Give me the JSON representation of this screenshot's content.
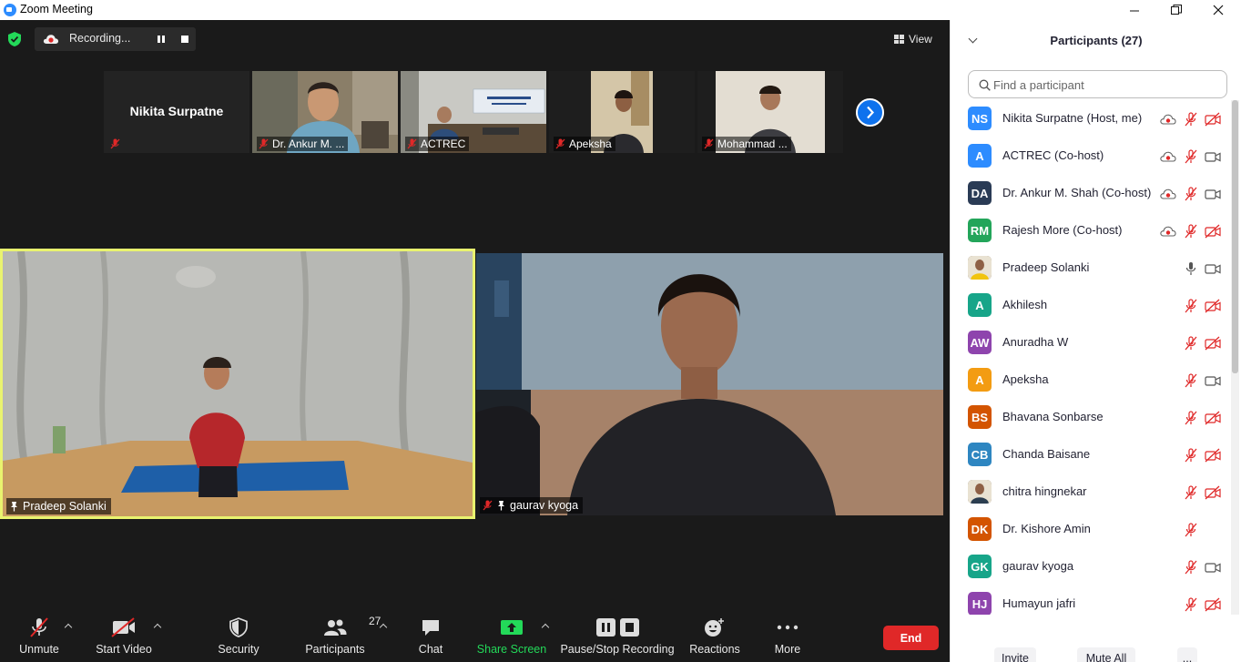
{
  "window": {
    "title": "Zoom Meeting",
    "minimize": "—",
    "maximize": "❐",
    "close": "✕"
  },
  "meeting": {
    "recording_label": "Recording...",
    "view_label": "View",
    "thumbnails": [
      {
        "name": "Nikita Surpatne",
        "video": false
      },
      {
        "name": "Dr. Ankur M. ...",
        "video": true
      },
      {
        "name": "ACTREC",
        "video": true
      },
      {
        "name": "Apeksha",
        "video": true
      },
      {
        "name": "Mohammad ...",
        "video": true
      }
    ],
    "main_videos": [
      {
        "name": "Pradeep Solanki",
        "active_speaker": true
      },
      {
        "name": "gaurav kyoga",
        "active_speaker": false
      }
    ]
  },
  "toolbar": {
    "unmute": "Unmute",
    "start_video": "Start Video",
    "security": "Security",
    "participants": "Participants",
    "participants_count": "27",
    "chat": "Chat",
    "share_screen": "Share Screen",
    "pause_stop_recording": "Pause/Stop Recording",
    "reactions": "Reactions",
    "more": "More",
    "end": "End"
  },
  "panel": {
    "title": "Participants (27)",
    "search_placeholder": "Find a participant",
    "participants": [
      {
        "initials": "NS",
        "name": "Nikita Surpatne (Host, me)",
        "color": "#2d8cff",
        "recording": true,
        "mic": "muted",
        "video": "off"
      },
      {
        "initials": "A",
        "name": "ACTREC (Co-host)",
        "color": "#2d8cff",
        "recording": true,
        "mic": "muted",
        "video": "on"
      },
      {
        "initials": "DA",
        "name": "Dr. Ankur M. Shah (Co-host)",
        "color": "#2a3b55",
        "recording": true,
        "mic": "muted",
        "video": "on"
      },
      {
        "initials": "RM",
        "name": "Rajesh More (Co-host)",
        "color": "#23a55a",
        "recording": true,
        "mic": "muted",
        "video": "off"
      },
      {
        "initials": "",
        "name": "Pradeep Solanki",
        "color": "photo",
        "recording": false,
        "mic": "on",
        "video": "on"
      },
      {
        "initials": "A",
        "name": "Akhilesh",
        "color": "#17a589",
        "recording": false,
        "mic": "muted",
        "video": "off"
      },
      {
        "initials": "AW",
        "name": "Anuradha W",
        "color": "#8e44ad",
        "recording": false,
        "mic": "muted",
        "video": "off"
      },
      {
        "initials": "A",
        "name": "Apeksha",
        "color": "#f39c12",
        "recording": false,
        "mic": "muted",
        "video": "on"
      },
      {
        "initials": "BS",
        "name": "Bhavana Sonbarse",
        "color": "#d35400",
        "recording": false,
        "mic": "muted",
        "video": "off"
      },
      {
        "initials": "CB",
        "name": "Chanda Baisane",
        "color": "#2e86c1",
        "recording": false,
        "mic": "muted",
        "video": "off"
      },
      {
        "initials": "",
        "name": "chitra hingnekar",
        "color": "photo",
        "recording": false,
        "mic": "muted",
        "video": "off"
      },
      {
        "initials": "DK",
        "name": "Dr. Kishore Amin",
        "color": "#d35400",
        "recording": false,
        "mic": "muted",
        "video": "none"
      },
      {
        "initials": "GK",
        "name": "gaurav kyoga",
        "color": "#17a589",
        "recording": false,
        "mic": "muted",
        "video": "on"
      },
      {
        "initials": "HJ",
        "name": "Humayun jafri",
        "color": "#8e44ad",
        "recording": false,
        "mic": "muted",
        "video": "off"
      }
    ],
    "invite": "Invite",
    "mute_all": "Mute All",
    "more": "..."
  }
}
